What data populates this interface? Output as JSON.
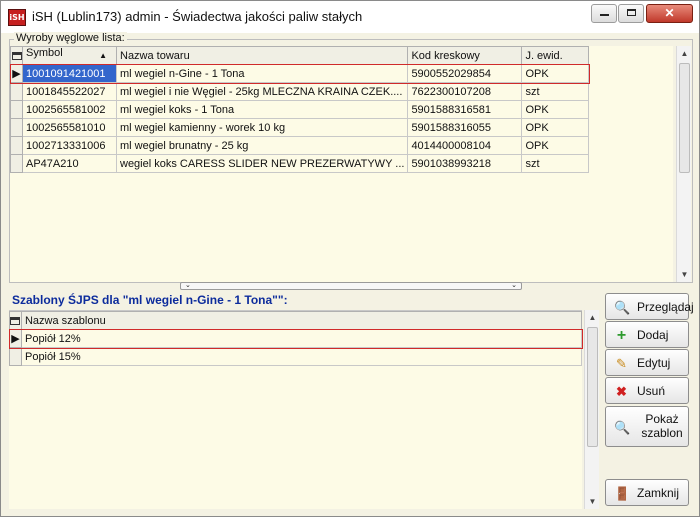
{
  "window": {
    "title": "iSH (Lublin173) admin - Świadectwa jakości paliw stałych",
    "app_icon_text": "iSH"
  },
  "products_group": {
    "label": "Wyroby węglowe lista:",
    "columns": [
      "Symbol",
      "Nazwa towaru",
      "Kod kreskowy",
      "J. ewid."
    ],
    "rows": [
      {
        "symbol": "1001091421001",
        "name": "ml wegiel n-Gine - 1 Tona",
        "barcode": "5900552029854",
        "unit": "OPK"
      },
      {
        "symbol": "1001845522027",
        "name": "ml wegiel i nie Węgiel  - 25kg  MLECZNA KRAINA CZEK....",
        "barcode": "7622300107208",
        "unit": "szt"
      },
      {
        "symbol": "1002565581002",
        "name": "ml wegiel koks - 1 Tona",
        "barcode": "5901588316581",
        "unit": "OPK"
      },
      {
        "symbol": "1002565581010",
        "name": "ml wegiel kamienny - worek 10 kg",
        "barcode": "5901588316055",
        "unit": "OPK"
      },
      {
        "symbol": "1002713331006",
        "name": "ml wegiel brunatny  - 25 kg",
        "barcode": "4014400008104",
        "unit": "OPK"
      },
      {
        "symbol": "AP47A210",
        "name": "wegiel koks CARESS SLIDER NEW PREZERWATYWY ...",
        "barcode": "5901038993218",
        "unit": "szt"
      }
    ],
    "selected_index": 0
  },
  "templates": {
    "title": "Szablony ŚJPS dla \"ml wegiel n-Gine - 1 Tona\"\":",
    "column": "Nazwa szablonu",
    "rows": [
      "Popiół 12%",
      "Popiół 15%"
    ],
    "selected_index": 0
  },
  "buttons": {
    "view": "Przeglądaj",
    "add": "Dodaj",
    "edit": "Edytuj",
    "delete": "Usuń",
    "show_template": "Pokaż szablon",
    "close": "Zamknij"
  },
  "colors": {
    "selection": "#3366cc",
    "row_outline": "#d02a2a",
    "grid_bg": "#fdfbe6",
    "window_bg": "#f4f2e3",
    "title_blue": "#0c2b9c"
  }
}
